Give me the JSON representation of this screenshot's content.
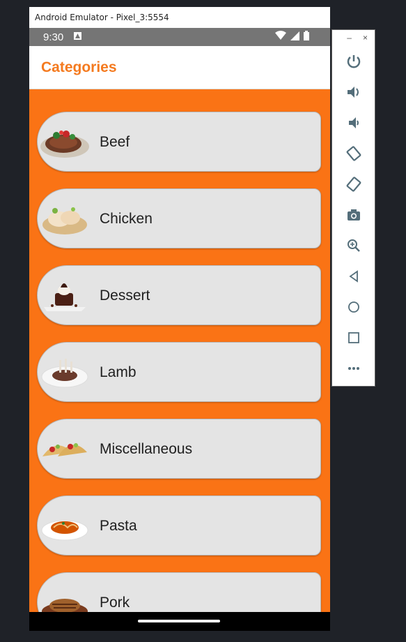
{
  "emulator": {
    "window_title": "Android Emulator - Pixel_3:5554"
  },
  "status_bar": {
    "time": "9:30"
  },
  "app_bar": {
    "title": "Categories"
  },
  "categories": [
    {
      "label": "Beef",
      "icon": "beef-steak-icon"
    },
    {
      "label": "Chicken",
      "icon": "chicken-icon"
    },
    {
      "label": "Dessert",
      "icon": "dessert-icon"
    },
    {
      "label": "Lamb",
      "icon": "lamb-icon"
    },
    {
      "label": "Miscellaneous",
      "icon": "taco-icon"
    },
    {
      "label": "Pasta",
      "icon": "pasta-icon"
    },
    {
      "label": "Pork",
      "icon": "pork-icon"
    }
  ],
  "toolbar": {
    "minimize_label": "–",
    "close_label": "×",
    "tools": [
      "power-icon",
      "volume-up-icon",
      "volume-down-icon",
      "rotate-left-icon",
      "rotate-right-icon",
      "camera-icon",
      "zoom-icon",
      "back-icon",
      "home-icon",
      "overview-icon",
      "more-icon"
    ]
  },
  "colors": {
    "accent": "#f47a1f",
    "content_bg": "#fa7315",
    "card_bg": "#e4e4e4"
  }
}
